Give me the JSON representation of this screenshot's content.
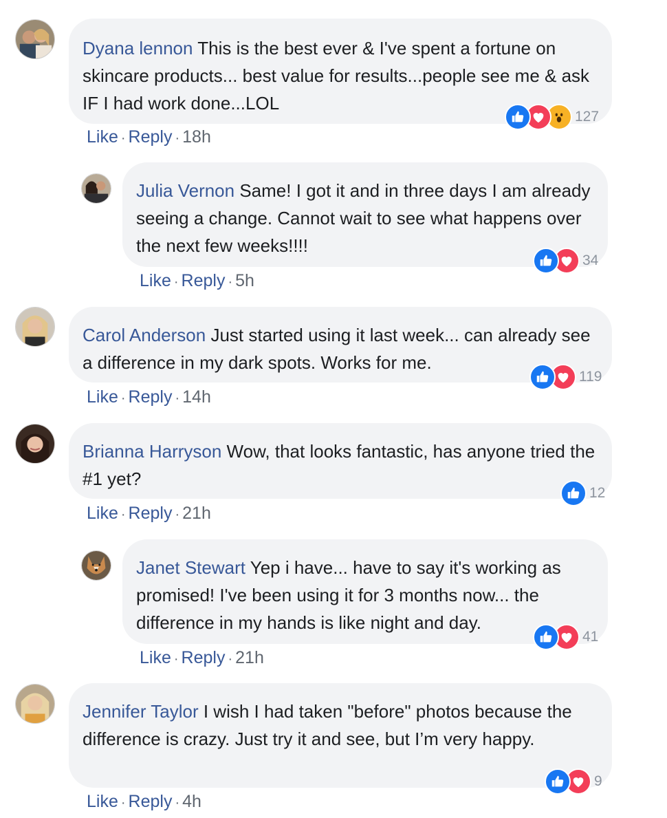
{
  "comments": [
    {
      "author": "Dyana lennon",
      "text": "This is the best ever & I've spent a fortune on skincare products... best value for results...people see me & ask IF I had work done...LOL",
      "reactions": [
        "like",
        "love",
        "wow"
      ],
      "reaction_count": "127",
      "like_label": "Like",
      "reply_label": "Reply",
      "time": "18h"
    },
    {
      "author": "Julia Vernon",
      "text": "Same! I got it and in three days I am already seeing a change. Cannot wait to see what happens over the next few weeks!!!!",
      "reactions": [
        "like",
        "love"
      ],
      "reaction_count": "34",
      "like_label": "Like",
      "reply_label": "Reply",
      "time": "5h"
    },
    {
      "author": "Carol Anderson",
      "text": "Just started using it last week... can already see a difference in my dark spots. Works for me.",
      "reactions": [
        "like",
        "love"
      ],
      "reaction_count": "119",
      "like_label": "Like",
      "reply_label": "Reply",
      "time": "14h"
    },
    {
      "author": "Brianna Harryson",
      "text": "Wow, that looks fantastic, has anyone tried the #1 yet?",
      "reactions": [
        "like"
      ],
      "reaction_count": "12",
      "like_label": "Like",
      "reply_label": "Reply",
      "time": "21h"
    },
    {
      "author": "Janet Stewart",
      "text": "Yep i have... have to say it's working as promised! I've been using it for 3 months now... the difference in my hands is like night and day.",
      "reactions": [
        "like",
        "love"
      ],
      "reaction_count": "41",
      "like_label": "Like",
      "reply_label": "Reply",
      "time": "21h"
    },
    {
      "author": "Jennifer Taylor",
      "text": "I wish I had taken \"before\" photos because the difference is crazy. Just try it and see, but I’m very happy.",
      "reactions": [
        "like",
        "love"
      ],
      "reaction_count": "9",
      "like_label": "Like",
      "reply_label": "Reply",
      "time": "4h"
    }
  ],
  "separator": "·",
  "reaction_icons": {
    "like": "thumbs-up-icon",
    "love": "heart-icon",
    "wow": "wow-face-icon"
  },
  "colors": {
    "link": "#385898",
    "bubble": "#f2f3f5",
    "like": "#1877f2",
    "love": "#f33e58",
    "wow": "#f7b125",
    "muted": "#606770"
  }
}
